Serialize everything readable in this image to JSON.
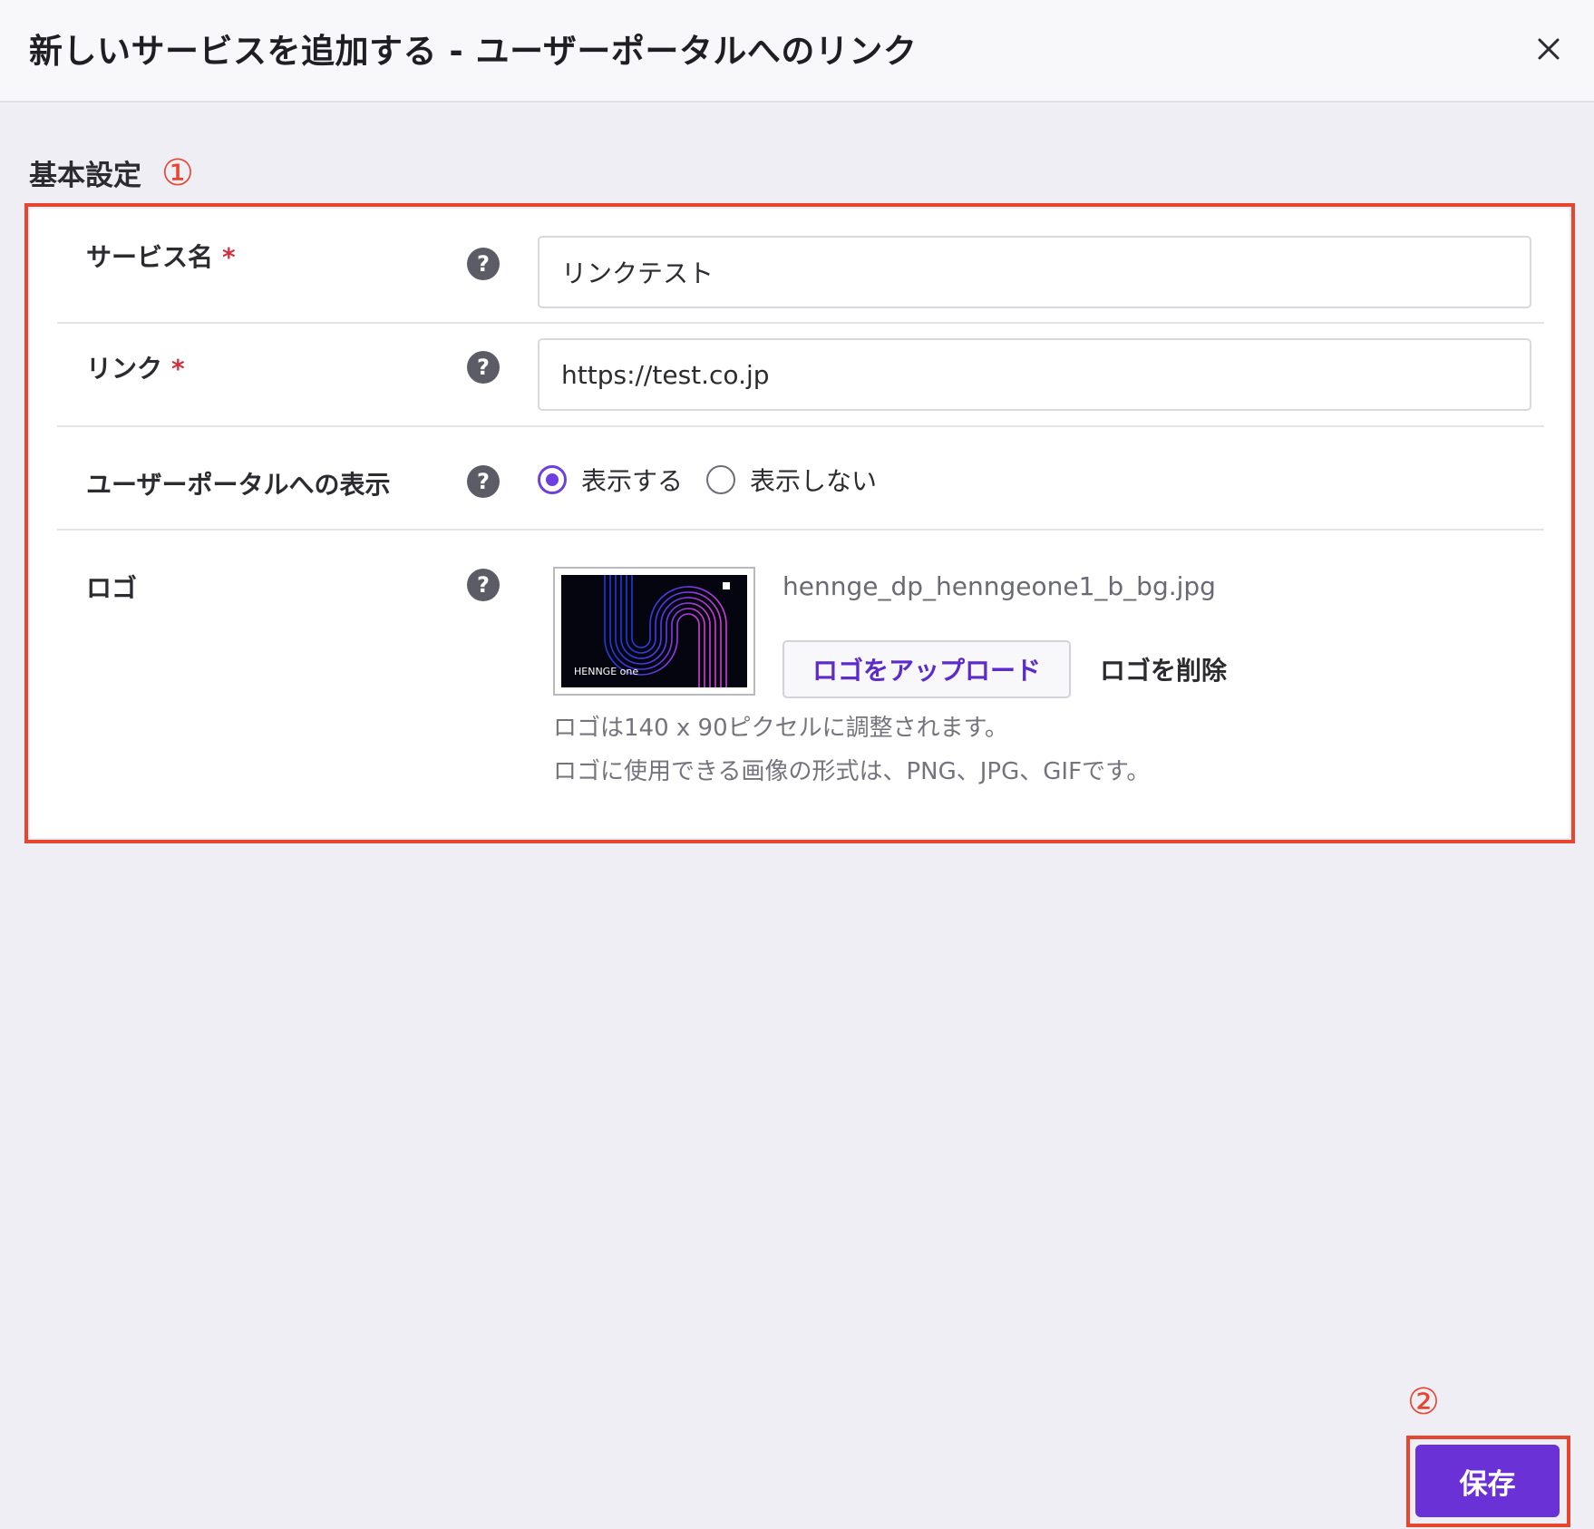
{
  "dialog": {
    "title": "新しいサービスを追加する - ユーザーポータルへのリンク",
    "close_icon": "close-icon"
  },
  "section": {
    "title": "基本設定",
    "annotation": "①"
  },
  "form": {
    "service_name": {
      "label": "サービス名",
      "required_mark": "*",
      "value": "リンクテスト",
      "help_icon": "?"
    },
    "link": {
      "label": "リンク",
      "required_mark": "*",
      "value": "https://test.co.jp",
      "help_icon": "?"
    },
    "portal_display": {
      "label": "ユーザーポータルへの表示",
      "help_icon": "?",
      "options": [
        {
          "label": "表示する",
          "checked": true
        },
        {
          "label": "表示しない",
          "checked": false
        }
      ]
    },
    "logo": {
      "label": "ロゴ",
      "help_icon": "?",
      "thumbnail_text": "HENNGE one",
      "filename": "hennge_dp_henngeone1_b_bg.jpg",
      "upload_label": "ロゴをアップロード",
      "delete_label": "ロゴを削除",
      "hint_size": "ロゴは140 x 90ピクセルに調整されます。",
      "hint_formats": "ロゴに使用できる画像の形式は、PNG、JPG、GIFです。"
    }
  },
  "footer": {
    "annotation": "②",
    "save_label": "保存"
  },
  "colors": {
    "accent": "#6a32d6",
    "annotation": "#e8452e",
    "required": "#d0303f",
    "background": "#efeef4"
  }
}
